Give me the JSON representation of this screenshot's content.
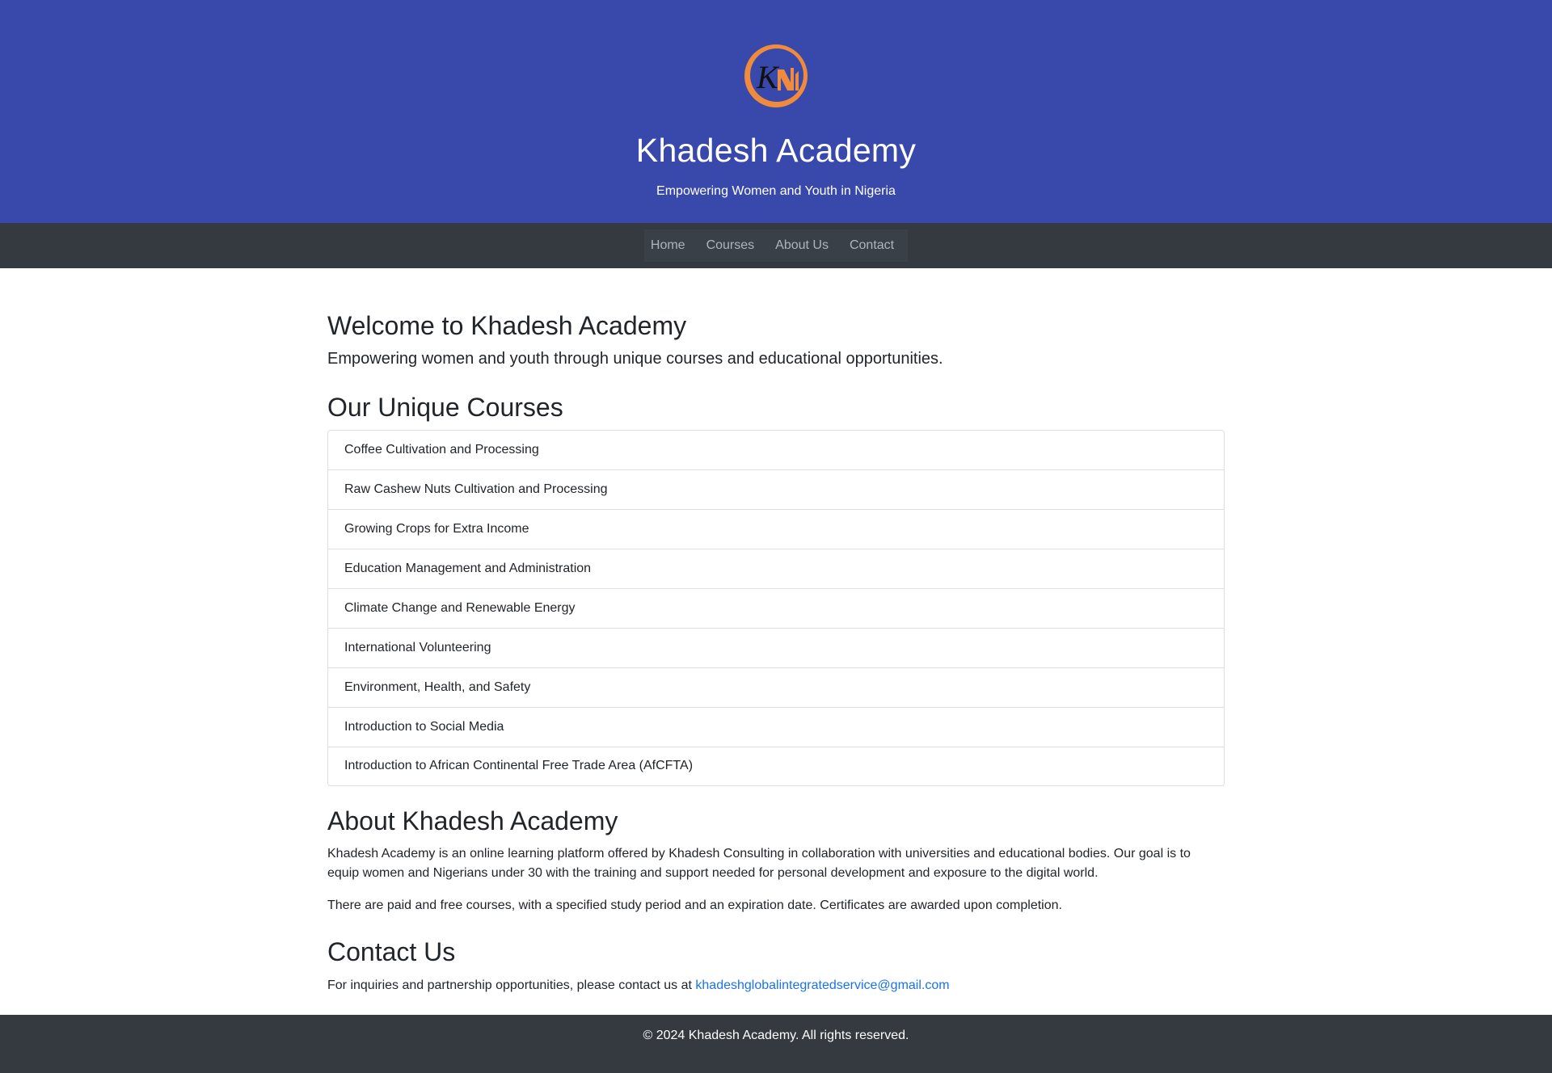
{
  "header": {
    "logo_alt": "Khadesh Academy logo",
    "title": "Khadesh Academy",
    "tagline": "Empowering Women and Youth in Nigeria"
  },
  "nav": {
    "items": [
      {
        "label": "Home"
      },
      {
        "label": "Courses"
      },
      {
        "label": "About Us"
      },
      {
        "label": "Contact"
      }
    ]
  },
  "welcome": {
    "heading": "Welcome to Khadesh Academy",
    "lead": "Empowering women and youth through unique courses and educational opportunities."
  },
  "courses": {
    "heading": "Our Unique Courses",
    "items": [
      "Coffee Cultivation and Processing",
      "Raw Cashew Nuts Cultivation and Processing",
      "Growing Crops for Extra Income",
      "Education Management and Administration",
      "Climate Change and Renewable Energy",
      "International Volunteering",
      "Environment, Health, and Safety",
      "Introduction to Social Media",
      "Introduction to African Continental Free Trade Area (AfCFTA)"
    ]
  },
  "about": {
    "heading": "About Khadesh Academy",
    "paragraph1": "Khadesh Academy is an online learning platform offered by Khadesh Consulting in collaboration with universities and educational bodies. Our goal is to equip women and Nigerians under 30 with the training and support needed for personal development and exposure to the digital world.",
    "paragraph2": "There are paid and free courses, with a specified study period and an expiration date. Certificates are awarded upon completion."
  },
  "contact": {
    "heading": "Contact Us",
    "text": "For inquiries and partnership opportunities, please contact us at",
    "email": "khadeshglobalintegratedservice@gmail.com"
  },
  "footer": {
    "text": "© 2024 Khadesh Academy. All rights reserved."
  },
  "colors": {
    "hero_bg": "#3949ab",
    "nav_bg": "#343a40",
    "footer_bg": "#343a40",
    "logo_orange": "#f08a3c",
    "link_blue": "#1a73e8"
  }
}
